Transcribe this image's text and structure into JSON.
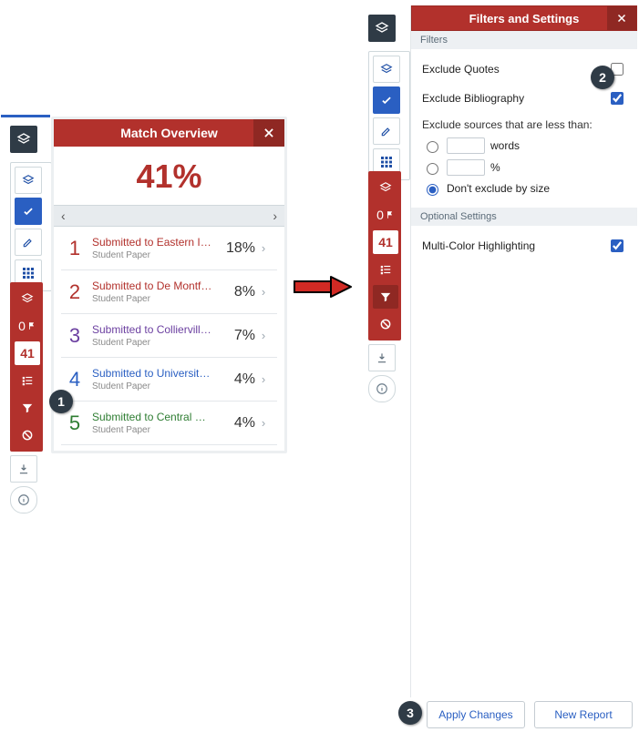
{
  "stepBadges": {
    "one": "1",
    "two": "2",
    "three": "3"
  },
  "matchOverview": {
    "title": "Match Overview",
    "percent": "41%",
    "nav_prev": "‹",
    "nav_next": "›",
    "toolbar": {
      "flag": "0",
      "score": "41"
    },
    "items": [
      {
        "n": "1",
        "title": "Submitted to Eastern In…",
        "sub": "Student Paper",
        "pct": "18%",
        "color": "#b2312c"
      },
      {
        "n": "2",
        "title": "Submitted to De Montf…",
        "sub": "Student Paper",
        "pct": "8%",
        "color": "#b2312c"
      },
      {
        "n": "3",
        "title": "Submitted to Colliervill…",
        "sub": "Student Paper",
        "pct": "7%",
        "color": "#6b3fa0"
      },
      {
        "n": "4",
        "title": "Submitted to University…",
        "sub": "Student Paper",
        "pct": "4%",
        "color": "#2a5fc2"
      },
      {
        "n": "5",
        "title": "Submitted to Central Q…",
        "sub": "Student Paper",
        "pct": "4%",
        "color": "#2e7d32"
      }
    ]
  },
  "filters": {
    "title": "Filters and Settings",
    "section_filters": "Filters",
    "exclude_quotes": "Exclude Quotes",
    "exclude_biblio": "Exclude Bibliography",
    "exclude_sources_heading": "Exclude sources that are less than:",
    "opt_words": "words",
    "opt_percent": "%",
    "opt_none": "Don't exclude by size",
    "section_optional": "Optional Settings",
    "multi_color": "Multi-Color Highlighting",
    "toolbar": {
      "flag": "0",
      "score": "41"
    },
    "apply": "Apply Changes",
    "new_report": "New Report"
  }
}
